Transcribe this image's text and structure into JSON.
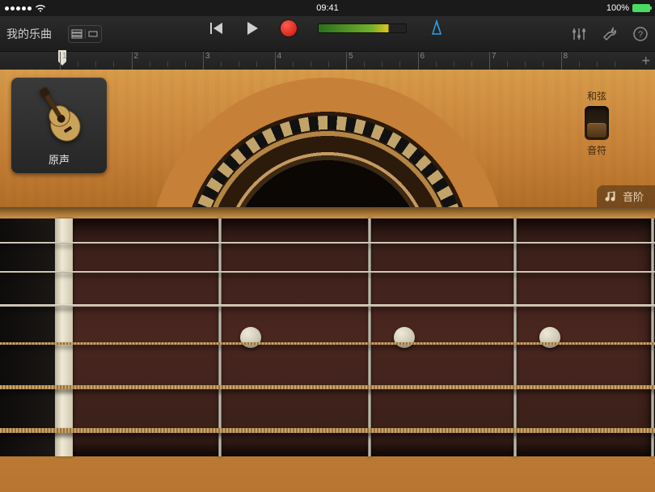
{
  "status": {
    "time": "09:41",
    "battery_pct": "100%"
  },
  "control": {
    "song_title": "我的乐曲"
  },
  "ruler": {
    "marks": [
      "1",
      "2",
      "3",
      "4",
      "5",
      "6",
      "7",
      "8"
    ]
  },
  "preset": {
    "label": "原声"
  },
  "mode": {
    "top_label": "和弦",
    "bottom_label": "音符",
    "state": "notes"
  },
  "scale_button": {
    "label": "音阶"
  }
}
